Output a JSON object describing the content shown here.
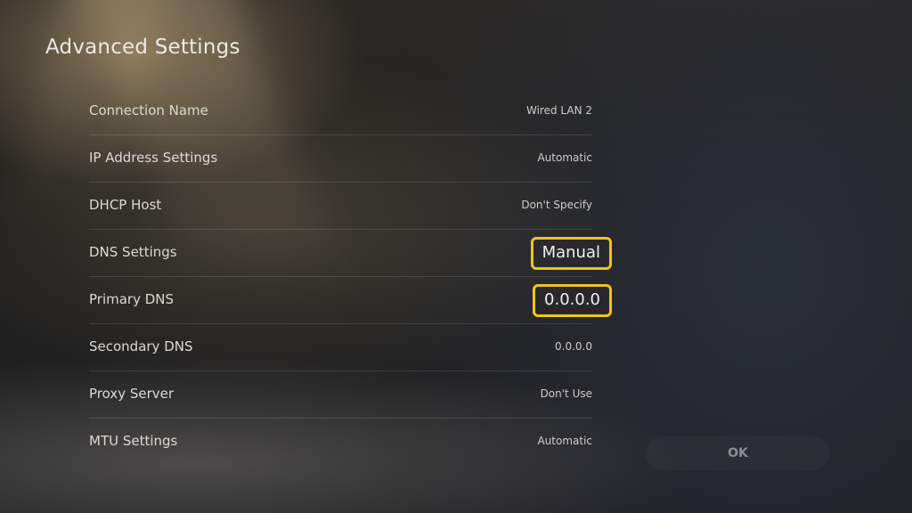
{
  "page": {
    "title": "Advanced Settings",
    "highlight_color": "#f3c318"
  },
  "settings": [
    {
      "label": "Connection Name",
      "value": "Wired LAN 2",
      "highlighted": false
    },
    {
      "label": "IP Address Settings",
      "value": "Automatic",
      "highlighted": false
    },
    {
      "label": "DHCP Host",
      "value": "Don't Specify",
      "highlighted": false
    },
    {
      "label": "DNS Settings",
      "value": "Manual",
      "highlighted": true
    },
    {
      "label": "Primary DNS",
      "value": "0.0.0.0",
      "highlighted": true
    },
    {
      "label": "Secondary DNS",
      "value": "0.0.0.0",
      "highlighted": false
    },
    {
      "label": "Proxy Server",
      "value": "Don't Use",
      "highlighted": false
    },
    {
      "label": "MTU Settings",
      "value": "Automatic",
      "highlighted": false
    }
  ],
  "actions": {
    "ok_label": "OK"
  }
}
